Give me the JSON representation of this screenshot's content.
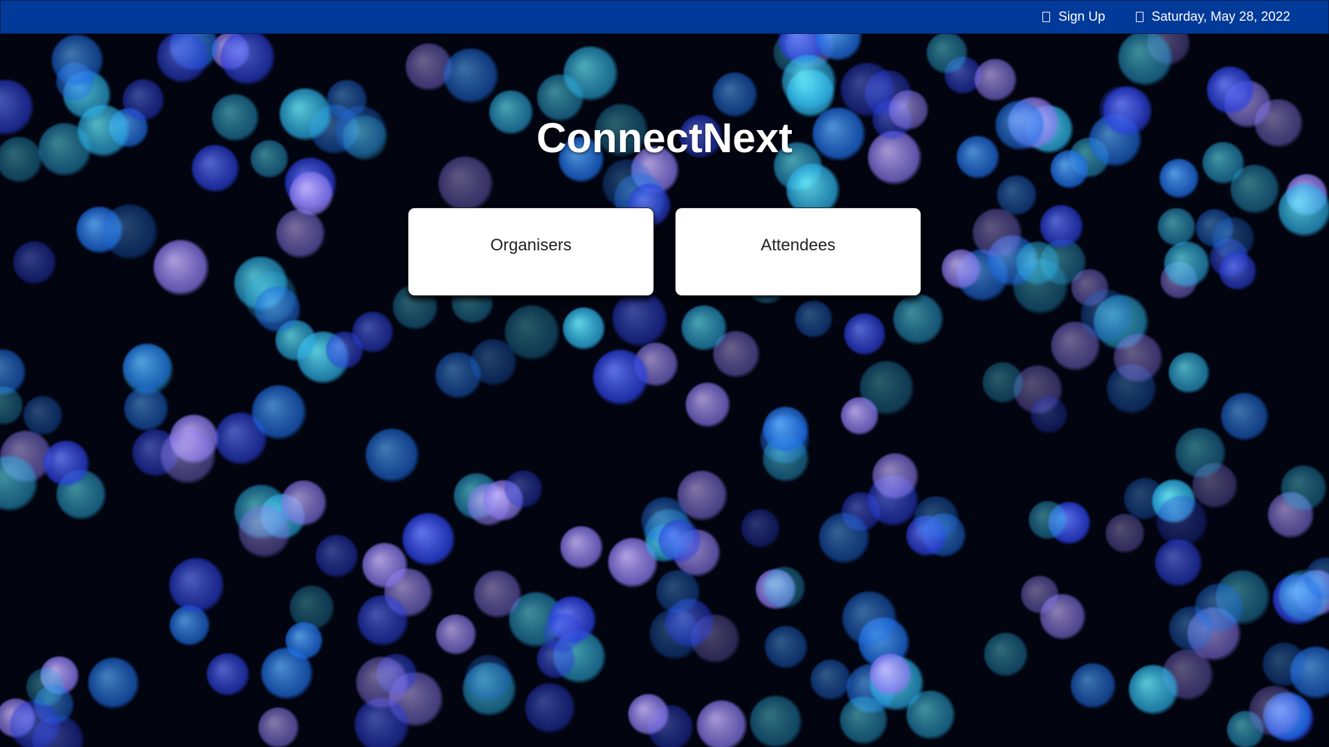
{
  "header": {
    "signup_label": "Sign Up",
    "date_label": "Saturday, May 28, 2022",
    "background_color": "#023a99"
  },
  "main": {
    "title": "ConnectNext",
    "cards": [
      {
        "label": "Organisers"
      },
      {
        "label": "Attendees"
      }
    ]
  },
  "background": {
    "description_colors": [
      "#1e6fe8",
      "#2bb0e6",
      "#8a78f0",
      "#2a3fe0"
    ],
    "base_color": "#02040f"
  }
}
